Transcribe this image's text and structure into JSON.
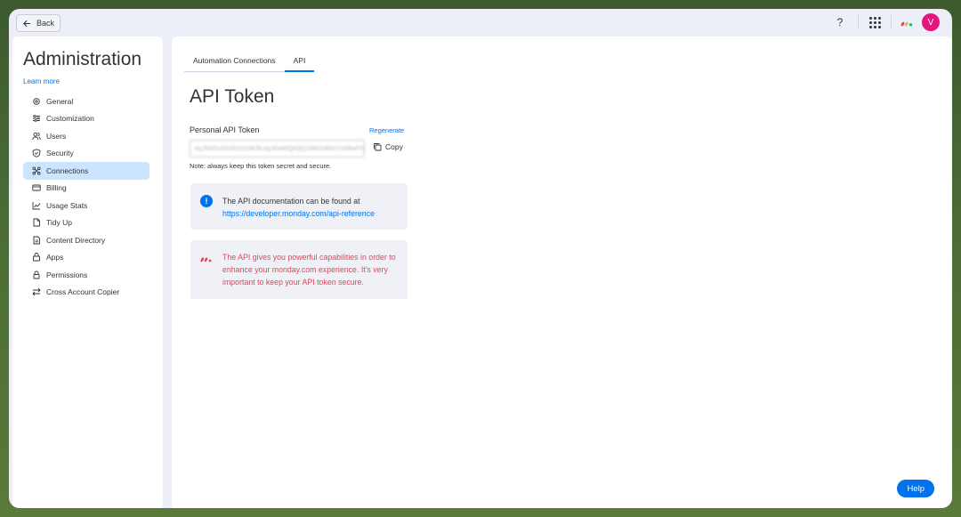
{
  "topbar": {
    "back_label": "Back",
    "help_symbol": "?",
    "avatar_initial": "V"
  },
  "sidebar": {
    "title": "Administration",
    "learn_more": "Learn more",
    "items": [
      {
        "label": "General",
        "icon": "gear-icon"
      },
      {
        "label": "Customization",
        "icon": "sliders-icon"
      },
      {
        "label": "Users",
        "icon": "users-icon"
      },
      {
        "label": "Security",
        "icon": "shield-icon"
      },
      {
        "label": "Connections",
        "icon": "connections-icon",
        "active": true
      },
      {
        "label": "Billing",
        "icon": "card-icon"
      },
      {
        "label": "Usage Stats",
        "icon": "chart-icon"
      },
      {
        "label": "Tidy Up",
        "icon": "broom-icon"
      },
      {
        "label": "Content Directory",
        "icon": "folder-icon"
      },
      {
        "label": "Apps",
        "icon": "apps-icon"
      },
      {
        "label": "Permissions",
        "icon": "lock-icon"
      },
      {
        "label": "Cross Account Copier",
        "icon": "arrows-icon"
      }
    ]
  },
  "main": {
    "tabs": [
      {
        "label": "Automation Connections",
        "active": false
      },
      {
        "label": "API",
        "active": true
      }
    ],
    "heading": "API Token",
    "token_label": "Personal API Token",
    "regenerate": "Regenerate",
    "token_value": "eyJhbGciOiJIUzI1NiJ9.eyJ0aWQiOjQ1MDc4MzYxMiwiYWFpIjoxMSwidWlkIjo",
    "copy_label": "Copy",
    "note": "Note: always keep this token secret and secure.",
    "info_text": "The API documentation can be found at",
    "info_link": "https://developer.monday.com/api-reference",
    "warn_text": "The API gives you powerful capabilities in order to enhance your monday.com experience. It's very important to keep your API token secure.",
    "help_label": "Help"
  },
  "colors": {
    "accent": "#0073ea",
    "active_nav": "#cce5ff",
    "warning_text": "#e2445c",
    "avatar": "#e2167e"
  }
}
